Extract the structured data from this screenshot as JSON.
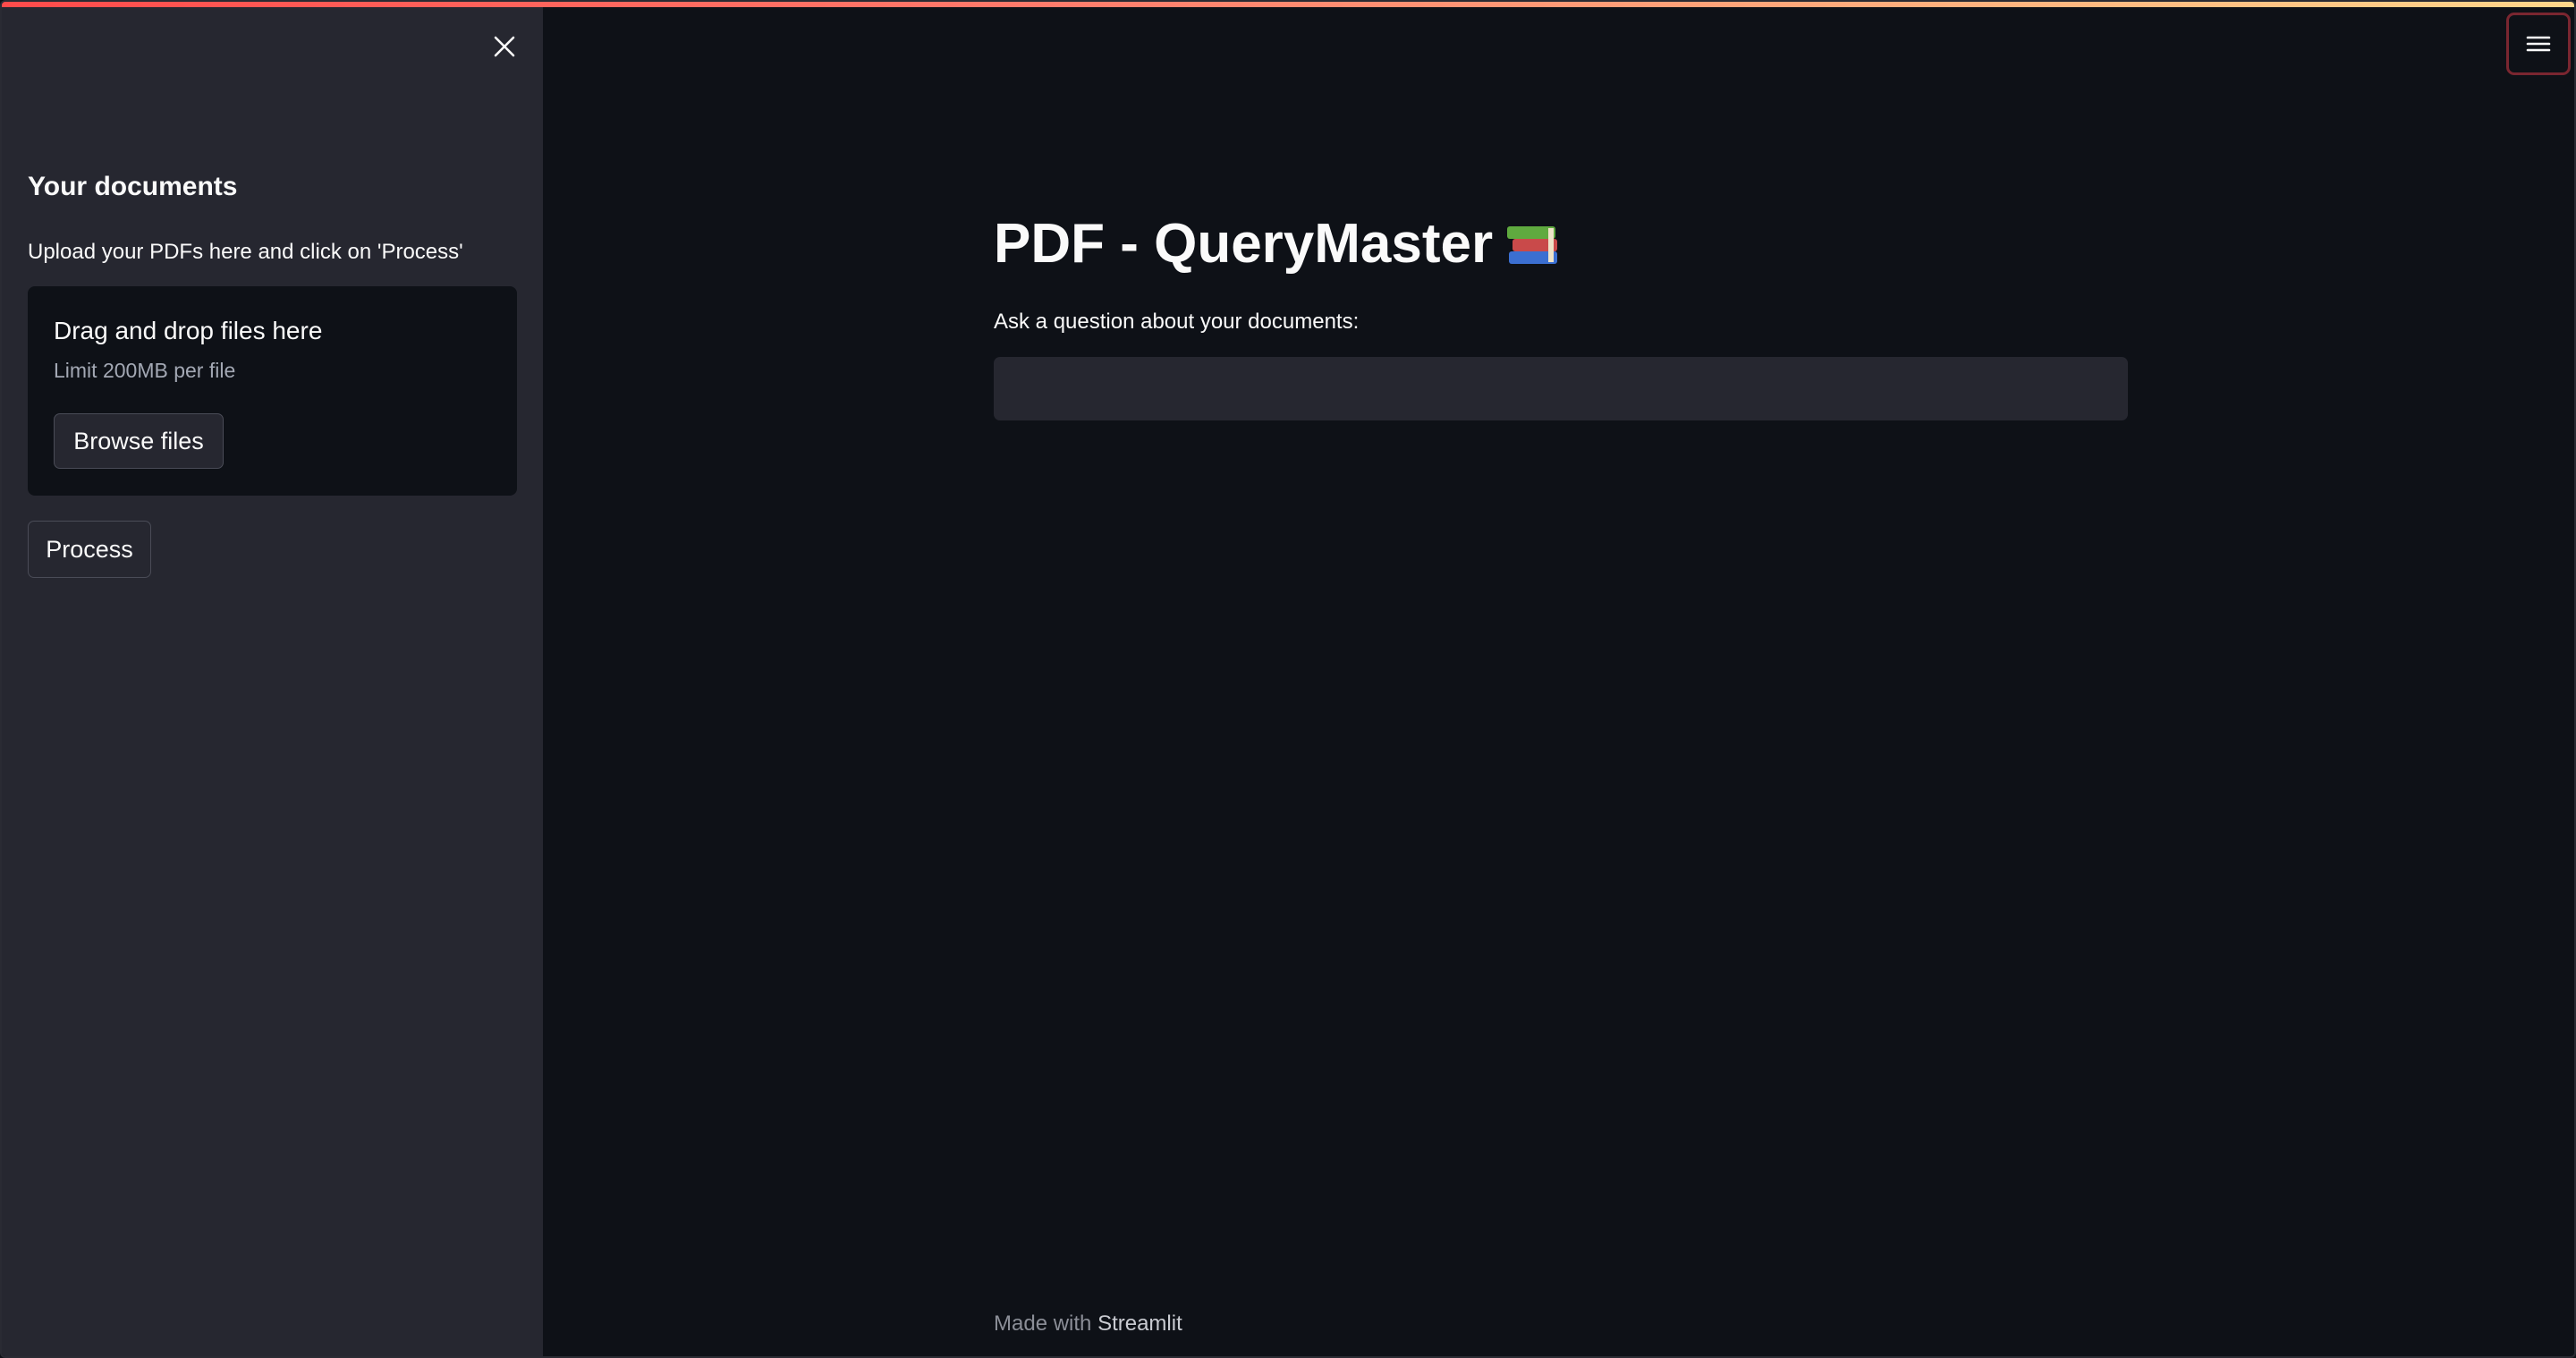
{
  "sidebar": {
    "heading": "Your documents",
    "caption": "Upload your PDFs here and click on 'Process'",
    "uploader": {
      "title": "Drag and drop files here",
      "limit": "Limit 200MB per file",
      "browse_label": "Browse files"
    },
    "process_label": "Process",
    "close_icon": "close-icon"
  },
  "main": {
    "title": "PDF - QueryMaster",
    "title_icon": "books-icon",
    "question_label": "Ask a question about your documents:",
    "question_value": "",
    "question_placeholder": ""
  },
  "header": {
    "menu_icon": "hamburger-menu-icon"
  },
  "footer": {
    "prefix": "Made with",
    "brand": "Streamlit"
  },
  "colors": {
    "background": "#0e1117",
    "sidebar": "#262730",
    "text": "#fafafa",
    "accent": "#ff4b4b"
  }
}
